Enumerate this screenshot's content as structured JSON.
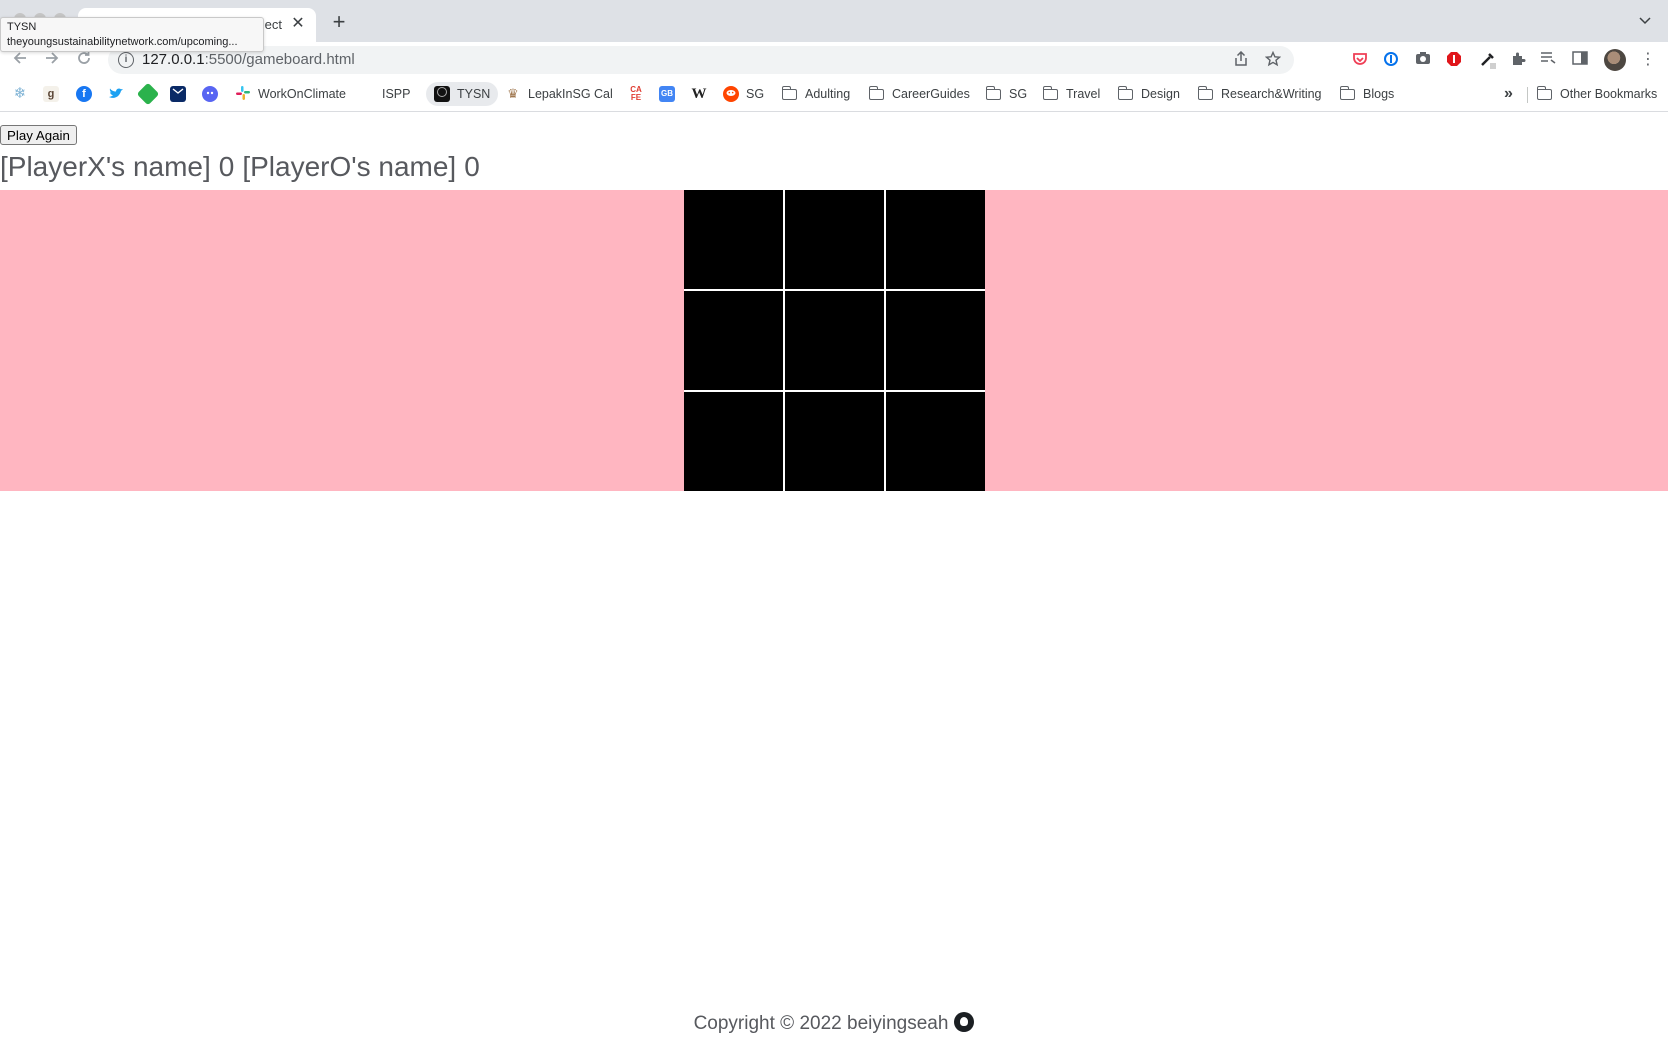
{
  "browser": {
    "tab": {
      "title": "ect",
      "close_glyph": "✕"
    },
    "new_tab_glyph": "+",
    "tooltip": {
      "title": "TYSN",
      "url": "theyoungsustainabilitynetwork.com/upcoming..."
    },
    "url": {
      "host": "127.0.0.1",
      "rest": ":5500/gameboard.html"
    },
    "bookmarks": [
      {
        "label": "",
        "icon": "snowflake-icon",
        "color": "#7fb3d5"
      },
      {
        "label": "",
        "icon": "goodreads-icon",
        "color": "#b8a27a"
      },
      {
        "label": "",
        "icon": "facebook-icon",
        "color": "#1877f2"
      },
      {
        "label": "",
        "icon": "twitter-icon",
        "color": "#1da1f2"
      },
      {
        "label": "",
        "icon": "feedly-icon",
        "color": "#2bb24c"
      },
      {
        "label": "",
        "icon": "mail-icon",
        "color": "#0a2a66"
      },
      {
        "label": "",
        "icon": "discord-icon",
        "color": "#5865f2"
      },
      {
        "label": "WorkOnClimate",
        "icon": "slack-icon",
        "color": "#e01e5a"
      },
      {
        "label": "ISPP",
        "icon": "",
        "color": ""
      },
      {
        "label": "TYSN",
        "icon": "tysn-icon",
        "color": "#111111"
      },
      {
        "label": "LepakInSG Cal",
        "icon": "lepak-icon",
        "color": "#c9a27a"
      },
      {
        "label": "",
        "icon": "cafe-icon",
        "color": "#e03c31"
      },
      {
        "label": "",
        "icon": "gmail-icon",
        "color": "#4285f4"
      },
      {
        "label": "",
        "icon": "wikipedia-icon",
        "color": "#222222"
      },
      {
        "label": "SG",
        "icon": "reddit-icon",
        "color": "#ff4500"
      },
      {
        "label": "Adulting",
        "icon": "folder-icon",
        "color": ""
      },
      {
        "label": "CareerGuides",
        "icon": "folder-icon",
        "color": ""
      },
      {
        "label": "SG",
        "icon": "folder-icon",
        "color": ""
      },
      {
        "label": "Travel",
        "icon": "folder-icon",
        "color": ""
      },
      {
        "label": "Design",
        "icon": "folder-icon",
        "color": ""
      },
      {
        "label": "Research&Writing",
        "icon": "folder-icon",
        "color": ""
      },
      {
        "label": "Blogs",
        "icon": "folder-icon",
        "color": ""
      }
    ],
    "overflow_glyph": "»",
    "other_bookmarks": "Other Bookmarks"
  },
  "game": {
    "play_again": "Play Again",
    "player_x_name": "[PlayerX's name]",
    "player_x_score": "0",
    "player_o_name": "[PlayerO's name]",
    "player_o_score": "0",
    "cells": [
      "",
      "",
      "",
      "",
      "",
      "",
      "",
      "",
      ""
    ],
    "colors": {
      "band": "#ffb6c1",
      "cell": "#000000",
      "grid_lines": "#ffffff",
      "text": "#57595e"
    }
  },
  "footer": {
    "text": "Copyright © 2022 beiyingseah",
    "icon": "github-icon"
  }
}
